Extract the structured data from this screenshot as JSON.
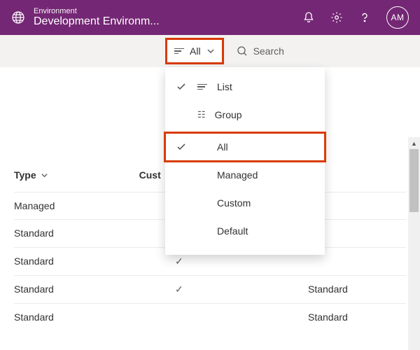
{
  "header": {
    "env_label": "Environment",
    "env_name": "Development Environm...",
    "avatar_initials": "AM"
  },
  "toolbar": {
    "filter_label": "All",
    "search_placeholder": "Search"
  },
  "dropdown": {
    "view_list": "List",
    "view_group": "Group",
    "filters": [
      "All",
      "Managed",
      "Custom",
      "Default"
    ],
    "selected": "All",
    "current_view": "List"
  },
  "table": {
    "col_type": "Type",
    "col_custom": "Cust",
    "rows": [
      {
        "type": "Managed",
        "custom": "",
        "extra": ""
      },
      {
        "type": "Standard",
        "custom": "✓",
        "extra": ""
      },
      {
        "type": "Standard",
        "custom": "✓",
        "extra": ""
      },
      {
        "type": "Standard",
        "custom": "✓",
        "extra": "Standard"
      },
      {
        "type": "Standard",
        "custom": "",
        "extra": "Standard"
      }
    ]
  }
}
